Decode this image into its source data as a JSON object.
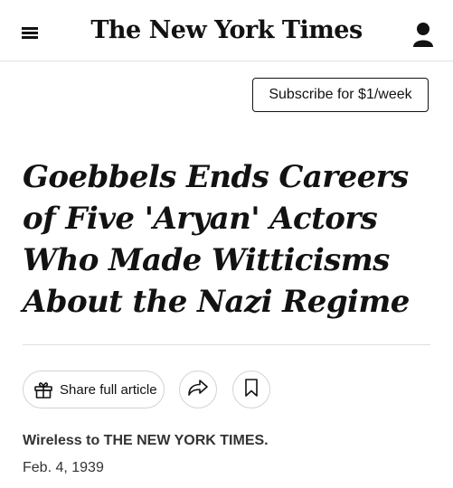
{
  "header": {
    "logo_text": "The New York Times",
    "menu_icon": "hamburger-menu-icon",
    "account_icon": "user-account-icon"
  },
  "subscribe": {
    "label": "Subscribe for $1/week"
  },
  "article": {
    "headline": "Goebbels Ends Careers of Five 'Aryan' Actors Who Made Witticisms About the Nazi Regime",
    "byline": "Wireless to THE NEW YORK TIMES.",
    "date": "Feb. 4, 1939"
  },
  "toolbar": {
    "share_label": "Share full article",
    "share_icon": "gift-icon",
    "forward_icon": "share-arrow-icon",
    "save_icon": "bookmark-icon"
  },
  "colors": {
    "text": "#121212",
    "meta_text": "#333333",
    "divider": "#dfdfdf",
    "button_border": "#d3d3d3"
  }
}
